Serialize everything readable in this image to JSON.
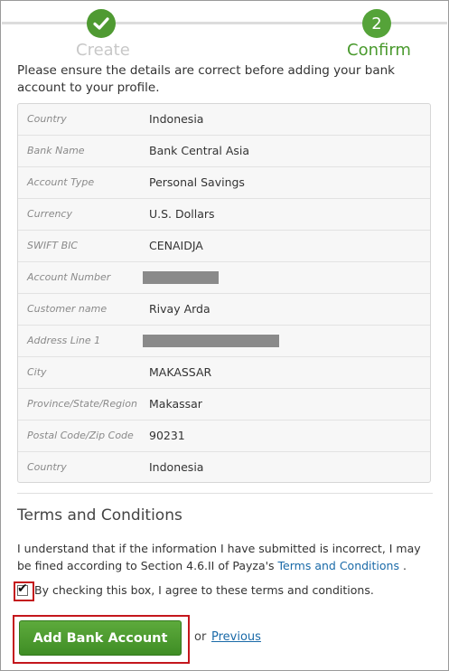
{
  "stepper": {
    "steps": [
      {
        "label": "Create",
        "state": "done"
      },
      {
        "label": "Confirm",
        "number": "2",
        "state": "active"
      }
    ]
  },
  "intro": "Please ensure the details are correct before adding your bank account to your profile.",
  "details": [
    {
      "label": "Country",
      "value": "Indonesia"
    },
    {
      "label": "Bank Name",
      "value": "Bank Central Asia"
    },
    {
      "label": "Account Type",
      "value": "Personal Savings"
    },
    {
      "label": "Currency",
      "value": "U.S. Dollars"
    },
    {
      "label": "SWIFT BIC",
      "value": "CENAIDJA"
    },
    {
      "label": "Account Number",
      "value": null,
      "redacted": true
    },
    {
      "label": "Customer name",
      "value": "Rivay Arda"
    },
    {
      "label": "Address Line 1",
      "value": null,
      "redacted": true
    },
    {
      "label": "City",
      "value": "MAKASSAR"
    },
    {
      "label": "Province/State/Region",
      "value": "Makassar"
    },
    {
      "label": "Postal Code/Zip Code",
      "value": "90231"
    },
    {
      "label": "Country",
      "value": "Indonesia"
    }
  ],
  "terms": {
    "title": "Terms and Conditions",
    "text_before": "I understand that if the information I have submitted is incorrect, I may be fined according to Section 4.6.II of Payza's ",
    "link": "Terms and Conditions",
    "text_after": " .",
    "checkbox_label": "By checking this box, I agree to these terms and conditions.",
    "checked": true
  },
  "actions": {
    "submit_label": "Add Bank Account",
    "or_text": "or",
    "previous_label": "Previous"
  },
  "colors": {
    "accent": "#4a9a2e",
    "link": "#1a6aa8",
    "highlight": "#c4161c"
  }
}
